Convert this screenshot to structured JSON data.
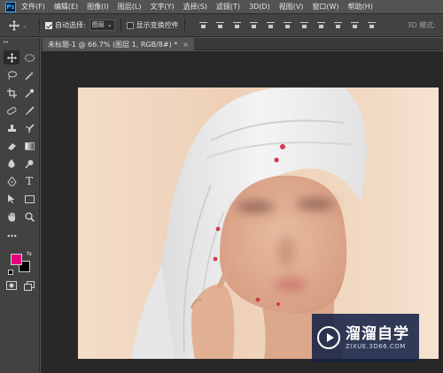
{
  "menubar": {
    "logo": "Ps",
    "items": [
      "文件(F)",
      "编辑(E)",
      "图像(I)",
      "图层(L)",
      "文字(Y)",
      "选择(S)",
      "滤镜(T)",
      "3D(D)",
      "视图(V)",
      "窗口(W)",
      "帮助(H)"
    ]
  },
  "options": {
    "auto_select_label": "自动选择:",
    "auto_select_checked": true,
    "auto_select_target": "图层",
    "show_transform_label": "显示变换控件",
    "show_transform_checked": false,
    "mode_3d_label": "3D 模式:"
  },
  "document": {
    "tab_label": "未标题-1 @ 66.7% (图层 1, RGB/8#) *",
    "close": "×"
  },
  "tools": {
    "collapse": "▸▸",
    "more": "•••"
  },
  "colors": {
    "foreground": "#e6007e",
    "background": "#000000"
  },
  "watermark": {
    "title": "溜溜自学",
    "url": "ZIXUE.3D66.COM"
  }
}
